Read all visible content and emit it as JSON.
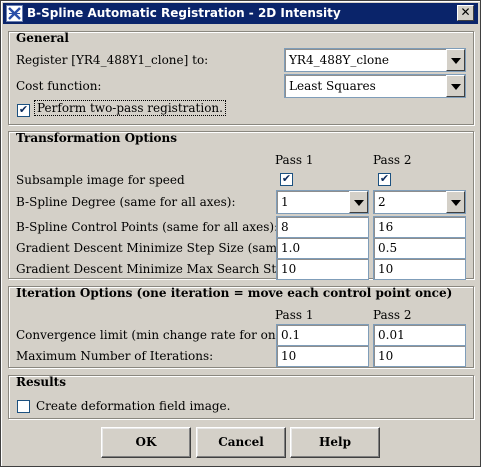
{
  "window": {
    "title": "B-Spline Automatic Registration - 2D Intensity",
    "close_glyph": "✕"
  },
  "general": {
    "title": "General",
    "register_label": "Register [YR4_488Y1_clone] to:",
    "register_value": "YR4_488Y_clone",
    "cost_label": "Cost function:",
    "cost_value": "Least Squares",
    "two_pass_label": "Perform two-pass registration.",
    "two_pass_checked": true
  },
  "transformation": {
    "title": "Transformation Options",
    "pass1_header": "Pass 1",
    "pass2_header": "Pass 2",
    "subsample_label": "Subsample image for speed",
    "subsample_pass1": true,
    "subsample_pass2": true,
    "degree_label": "B-Spline Degree (same for all axes):",
    "degree_pass1": "1",
    "degree_pass2": "2",
    "control_points_label": "B-Spline Control Points (same for all axes):",
    "control_points_pass1": "8",
    "control_points_pass2": "16",
    "step_size_label": "Gradient Descent Minimize Step Size (sample units):",
    "step_size_pass1": "1.0",
    "step_size_pass2": "0.5",
    "max_search_label": "Gradient Descent Minimize Max Search Steps:",
    "max_search_pass1": "10",
    "max_search_pass2": "10"
  },
  "iteration": {
    "title": "Iteration Options (one iteration = move each control point once)",
    "pass1_header": "Pass 1",
    "pass2_header": "Pass 2",
    "convergence_label": "Convergence limit (min change rate for one iteration):",
    "convergence_pass1": "0.1",
    "convergence_pass2": "0.01",
    "max_iter_label": "Maximum Number of Iterations:",
    "max_iter_pass1": "10",
    "max_iter_pass2": "10"
  },
  "results": {
    "title": "Results",
    "deformation_label": "Create deformation field image.",
    "deformation_checked": false
  },
  "buttons": {
    "ok": "OK",
    "cancel": "Cancel",
    "help": "Help"
  },
  "check_glyph": "✔"
}
